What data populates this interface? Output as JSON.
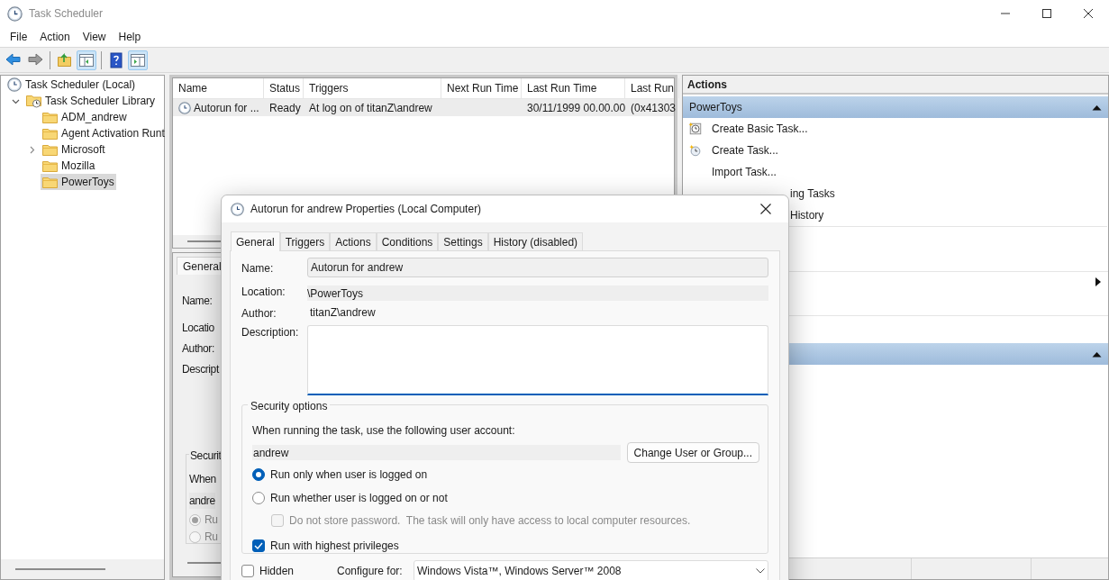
{
  "window": {
    "title": "Task Scheduler"
  },
  "menu": [
    "File",
    "Action",
    "View",
    "Help"
  ],
  "toolbar": [
    {
      "kind": "back",
      "pressed": false
    },
    {
      "kind": "forward",
      "pressed": false
    },
    {
      "kind": "separator"
    },
    {
      "kind": "up",
      "pressed": false
    },
    {
      "kind": "tree_toggle",
      "pressed": true
    },
    {
      "kind": "separator"
    },
    {
      "kind": "help",
      "pressed": false
    },
    {
      "kind": "actions_toggle",
      "pressed": true
    }
  ],
  "tree": [
    {
      "label": "Task Scheduler (Local)",
      "kind": "computer",
      "selected": false,
      "children": [
        {
          "label": "Task Scheduler Library",
          "kind": "library",
          "expanded": true,
          "selected": false,
          "children": [
            {
              "label": "ADM_andrew",
              "kind": "folder",
              "selected": false
            },
            {
              "label": "Agent Activation Runt",
              "kind": "folder",
              "selected": false
            },
            {
              "label": "Microsoft",
              "kind": "folder",
              "expanded": false,
              "selected": false
            },
            {
              "label": "Mozilla",
              "kind": "folder",
              "selected": false
            },
            {
              "label": "PowerToys",
              "kind": "folder",
              "selected": true
            }
          ]
        }
      ]
    }
  ],
  "task_list": {
    "columns": [
      "Name",
      "Status",
      "Triggers",
      "Next Run Time",
      "Last Run Time",
      "Last Run"
    ],
    "rows": [
      {
        "selected": true,
        "cells": [
          "Autorun for ...",
          "Ready",
          "At log on of titanZ\\andrew",
          null,
          "30/11/1999 00.00.00",
          "(0x41303"
        ]
      }
    ]
  },
  "details_pane": {
    "tab": "General",
    "labels": [
      "Name:",
      "Locatio",
      "Author:",
      "Descript"
    ],
    "security_title": "Securit",
    "security_prompt": "When",
    "account": "andre",
    "radios": [
      {
        "label": "Ru",
        "selected": true
      },
      {
        "label": "Ru",
        "selected": false
      }
    ]
  },
  "actions_pane": {
    "title": "Actions",
    "sections": [
      {
        "title": "PowerToys",
        "expanded": true,
        "items": [
          {
            "kind": "basic_task",
            "label": "Create Basic Task..."
          },
          {
            "kind": "create_task",
            "label": "Create Task..."
          },
          {
            "kind": "plain",
            "label": "Import Task..."
          },
          {
            "kind": "covered",
            "label": "ing Tasks"
          },
          {
            "kind": "covered",
            "label": "History"
          },
          {
            "kind": "separator"
          },
          {
            "kind": "submenu"
          }
        ]
      },
      {
        "expanded": true
      }
    ]
  },
  "dialog": {
    "title": "Autorun for andrew Properties (Local Computer)",
    "tabs": [
      {
        "label": "General",
        "selected": true
      },
      {
        "label": "Triggers",
        "selected": false
      },
      {
        "label": "Actions",
        "selected": false
      },
      {
        "label": "Conditions",
        "selected": false
      },
      {
        "label": "Settings",
        "selected": false
      },
      {
        "label": "History (disabled)",
        "selected": false
      }
    ],
    "name_label": "Name:",
    "name": "Autorun for andrew",
    "location_label": "Location:",
    "location": "\\PowerToys",
    "author_label": "Author:",
    "author": "titanZ\\andrew",
    "description_label": "Description:",
    "security": {
      "title": "Security options",
      "prompt": "When running the task, use the following user account:",
      "account": "andrew",
      "change_button": "Change User or Group...",
      "options": [
        {
          "kind": "radio",
          "label": "Run only when user is logged on",
          "selected": true
        },
        {
          "kind": "radio",
          "label": "Run whether user is logged on or not",
          "selected": false
        },
        {
          "kind": "checkbox",
          "label": "Do not store password.  The task will only have access to local computer resources.",
          "checked": false,
          "disabled": true
        },
        {
          "kind": "checkbox",
          "label": "Run with highest privileges",
          "checked": true
        }
      ]
    },
    "hidden": {
      "label": "Hidden",
      "checked": false
    },
    "configure_label": "Configure for:",
    "configure_value": "Windows Vista™, Windows Server™ 2008"
  }
}
